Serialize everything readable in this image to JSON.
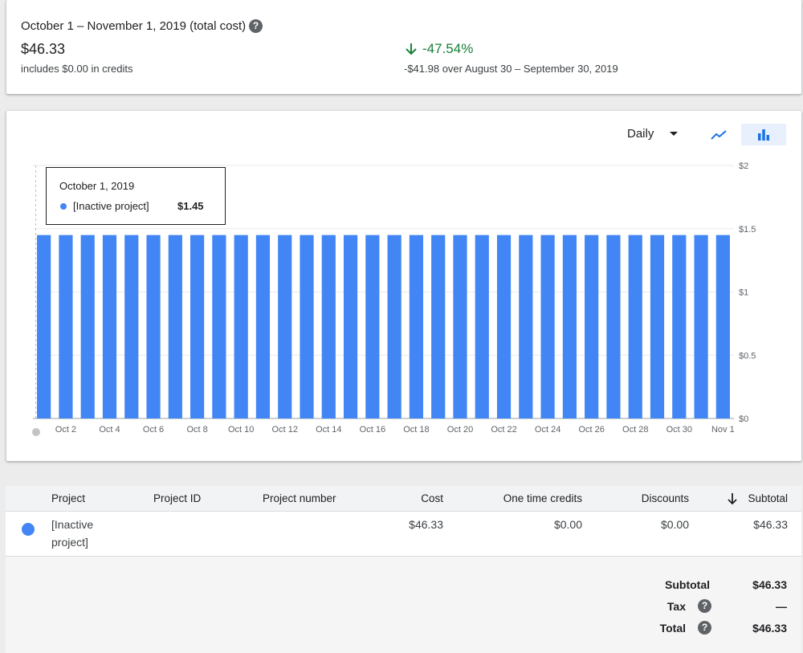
{
  "summary": {
    "title": "October 1 – November 1, 2019 (total cost)",
    "help_icon": "?",
    "total": "$46.33",
    "credits_note": "includes $0.00 in credits",
    "change_pct": "-47.54%",
    "change_detail": "-$41.98 over August 30 – September 30, 2019",
    "change_color": "#188038"
  },
  "controls": {
    "granularity": "Daily",
    "line_icon": "line-chart-icon",
    "bar_icon": "bar-chart-icon",
    "selected_view": "bar"
  },
  "tooltip": {
    "date": "October 1, 2019",
    "series": "[Inactive project]",
    "value": "$1.45"
  },
  "chart_data": {
    "type": "bar",
    "series": [
      {
        "name": "[Inactive project]",
        "color": "#4285f4",
        "values": [
          1.45,
          1.45,
          1.45,
          1.45,
          1.45,
          1.45,
          1.45,
          1.45,
          1.45,
          1.45,
          1.45,
          1.45,
          1.45,
          1.45,
          1.45,
          1.45,
          1.45,
          1.45,
          1.45,
          1.45,
          1.45,
          1.45,
          1.45,
          1.45,
          1.45,
          1.45,
          1.45,
          1.45,
          1.45,
          1.45,
          1.45,
          1.45
        ]
      }
    ],
    "x_tick_labels": [
      "Oct 2",
      "Oct 4",
      "Oct 6",
      "Oct 8",
      "Oct 10",
      "Oct 12",
      "Oct 14",
      "Oct 16",
      "Oct 18",
      "Oct 20",
      "Oct 22",
      "Oct 24",
      "Oct 26",
      "Oct 28",
      "Oct 30",
      "Nov 1"
    ],
    "y_tick_labels": [
      "$0",
      "$0.5",
      "$1",
      "$1.5",
      "$2"
    ],
    "y_ticks": [
      0,
      0.5,
      1,
      1.5,
      2
    ],
    "ylim": [
      0,
      2
    ],
    "grid": true
  },
  "table": {
    "headers": {
      "project": "Project",
      "project_id": "Project ID",
      "project_number": "Project number",
      "cost": "Cost",
      "one_time_credits": "One time credits",
      "discounts": "Discounts",
      "subtotal": "Subtotal"
    },
    "rows": [
      {
        "project_line1": "[Inactive",
        "project_line2": "project]",
        "cost": "$46.33",
        "credits": "$0.00",
        "discounts": "$0.00",
        "subtotal": "$46.33"
      }
    ],
    "totals": {
      "subtotal_label": "Subtotal",
      "subtotal_value": "$46.33",
      "tax_label": "Tax",
      "tax_value": "—",
      "total_label": "Total",
      "total_value": "$46.33"
    }
  }
}
